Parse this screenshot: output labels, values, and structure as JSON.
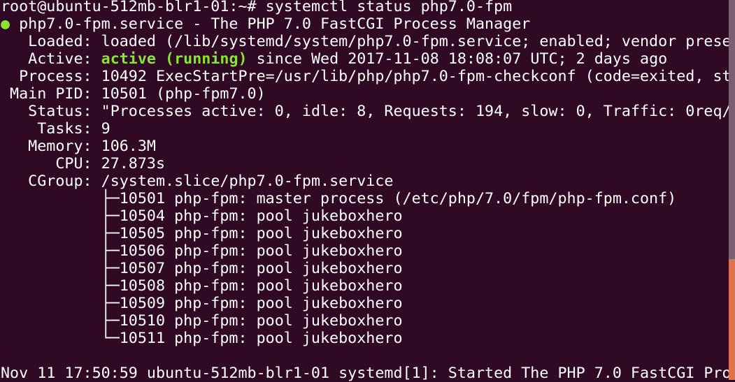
{
  "colors": {
    "background": "#300a24",
    "text": "#ffffff",
    "active": "#8ae234",
    "scroll_thumb": "#dd7450"
  },
  "prompt": "root@ubuntu-512mb-blr1-01:~# ",
  "command": "systemctl status php7.0-fpm",
  "service": {
    "dot": "●",
    "title": " php7.0-fpm.service - The PHP 7.0 FastCGI Process Manager",
    "loaded_label": "   Loaded: ",
    "loaded": "loaded (/lib/systemd/system/php7.0-fpm.service; enabled; vendor prese",
    "active_label": "   Active: ",
    "active_state": "active (running)",
    "active_since": " since Wed 2017-11-08 18:08:07 UTC; 2 days ago",
    "process_label": "  Process: ",
    "process": "10492 ExecStartPre=/usr/lib/php/php7.0-fpm-checkconf (code=exited, st",
    "mainpid_label": " Main PID: ",
    "mainpid": "10501 (php-fpm7.0)",
    "status_label": "   Status: ",
    "status": "\"Processes active: 0, idle: 8, Requests: 194, slow: 0, Traffic: 0req/",
    "tasks_label": "    Tasks: ",
    "tasks": "9",
    "memory_label": "   Memory: ",
    "memory": "106.3M",
    "cpu_label": "      CPU: ",
    "cpu": "27.873s",
    "cgroup_label": "   CGroup: ",
    "cgroup": "/system.slice/php7.0-fpm.service",
    "tree": [
      "           ├─10501 php-fpm: master process (/etc/php/7.0/fpm/php-fpm.conf)",
      "           ├─10504 php-fpm: pool jukeboxhero",
      "           ├─10505 php-fpm: pool jukeboxhero",
      "           ├─10506 php-fpm: pool jukeboxhero",
      "           ├─10507 php-fpm: pool jukeboxhero",
      "           ├─10508 php-fpm: pool jukeboxhero",
      "           ├─10509 php-fpm: pool jukeboxhero",
      "           ├─10510 php-fpm: pool jukeboxhero",
      "           └─10511 php-fpm: pool jukeboxhero"
    ]
  },
  "log": "Nov 11 17:50:59 ubuntu-512mb-blr1-01 systemd[1]: Started The PHP 7.0 FastCGI Pro"
}
